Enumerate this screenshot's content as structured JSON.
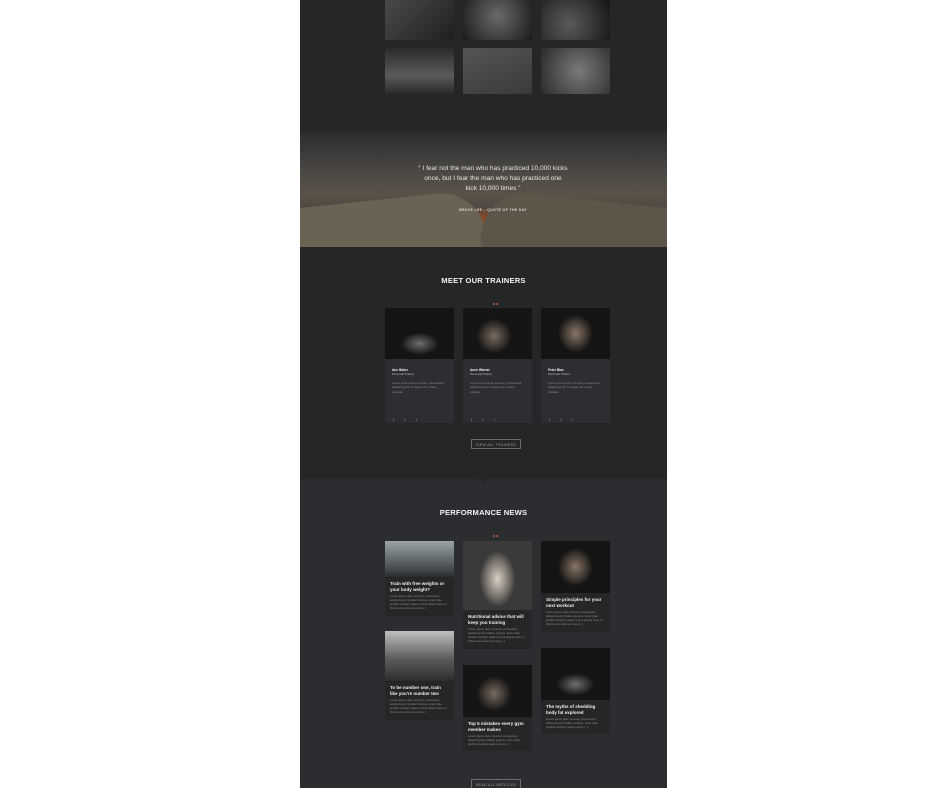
{
  "colors": {
    "page_bg": "#242628",
    "news_bg": "#2b2d30",
    "accent": "#c25a2c",
    "card_bg": "#2c2e31"
  },
  "quote": {
    "text": "“ I fear not the man who has practiced 10,000 kicks once, but I fear the man who has practiced one kick 10,000 times ”",
    "author": "BRUCE LEE – QUOTE OF THE DAY"
  },
  "trainers": {
    "heading": "MEET OUR TRAINERS",
    "items": [
      {
        "name": "Ann Baker",
        "role": "Personal Trainer",
        "desc": "Lorem ipsum dolor sit amet, consectetur adipiscing elit. In augue elit, ornare volutpat.",
        "socials": [
          "f",
          "t",
          "i"
        ]
      },
      {
        "name": "Anne Warner",
        "role": "Personal Trainer",
        "desc": "Lorem ipsum dolor sit amet, consectetur adipiscing elit. In augue elit, ornare volutpat.",
        "socials": [
          "f",
          "t",
          "i"
        ]
      },
      {
        "name": "Peter Blue",
        "role": "Personal Trainer",
        "desc": "Lorem ipsum dolor sit amet, consectetur adipiscing elit. In augue elit, ornare volutpat.",
        "socials": [
          "f",
          "t",
          "i"
        ]
      }
    ],
    "button": "VIEW ALL TRAINERS"
  },
  "news": {
    "heading": "PERFORMANCE NEWS",
    "items": [
      {
        "title": "Train with free weights or your body weight?",
        "excerpt": "Lorem ipsum dolor sit amet, consectetur adipiscing elit. Nullam pretium, tortor vitae porttitor suscipit, sapien purus aliquet risus, et finibus arcu ante nec risus [...]"
      },
      {
        "title": "To be number one, train like you're number two",
        "excerpt": "Lorem ipsum dolor sit amet, consectetur adipiscing elit. Nullam pretium, tortor vitae porttitor suscipit, sapien purus aliquet risus, et finibus arcu ante nec risus [...]"
      },
      {
        "title": "Nutritional advice that will keep you training",
        "excerpt": "Lorem ipsum dolor sit amet, consectetur adipiscing elit. Nullam pretium, tortor vitae porttitor suscipit, sapien purus aliquet risus, et finibus arcu ante nec risus [...]"
      },
      {
        "title": "Top 5 mistakes every gym member makes",
        "excerpt": "Lorem ipsum dolor sit amet, consectetur adipiscing elit. Nullam pretium, tortor vitae porttitor suscipit, sapien purus [...]"
      },
      {
        "title": "Simple principles for your next workout",
        "excerpt": "Lorem ipsum dolor sit amet, consectetur adipiscing elit. Nullam pretium, tortor vitae porttitor suscipit, sapien purus aliquet risus, et finibus arcu ante nec risus [...]"
      },
      {
        "title": "The myths of shedding body fat explored",
        "excerpt": "Lorem ipsum dolor sit amet, consectetur adipiscing elit. Nullam pretium, tortor vitae porttitor suscipit, sapien purus [...]"
      }
    ],
    "button": "READ ALL ARTICLES"
  }
}
